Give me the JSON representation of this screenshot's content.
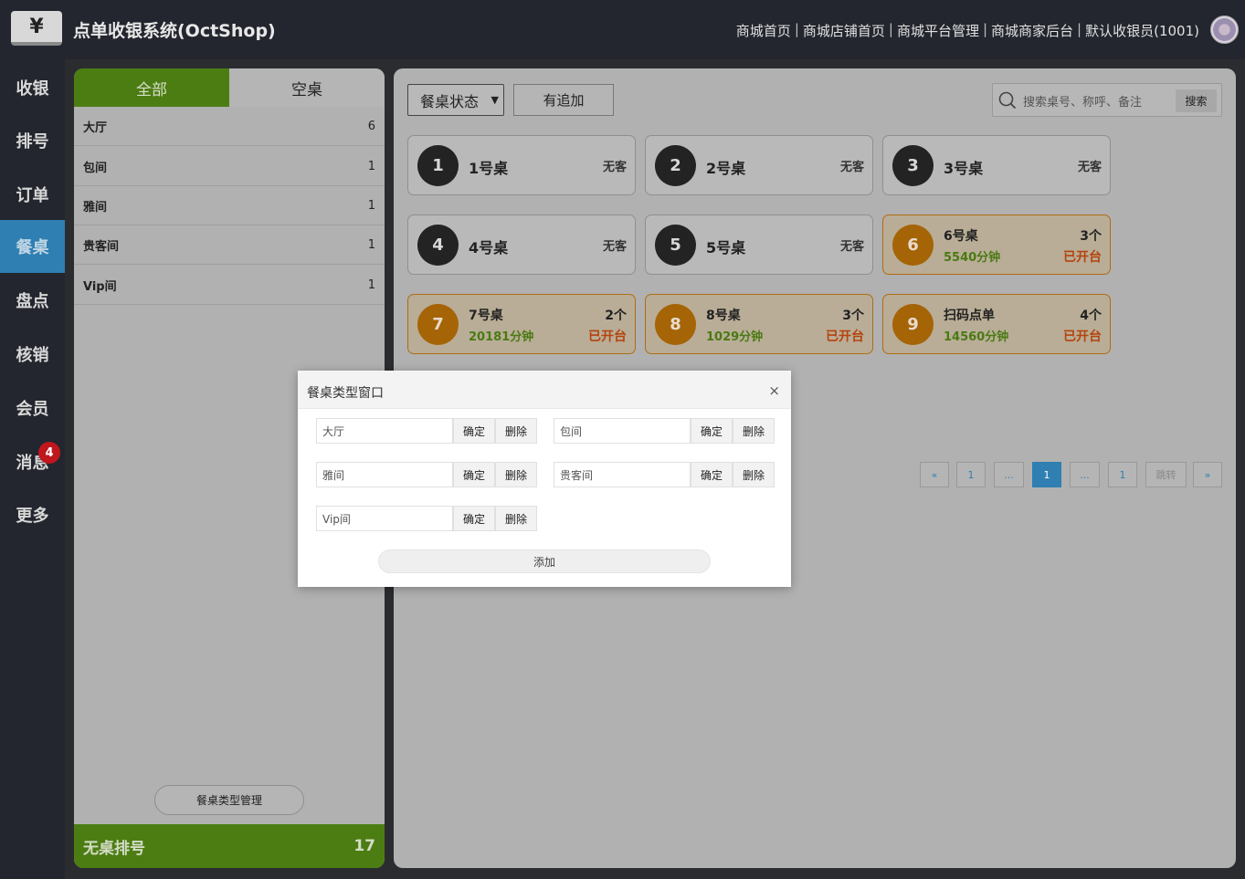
{
  "header": {
    "logo_glyph": "¥",
    "title": "点单收银系统(OctShop)",
    "nav": [
      "商城首页",
      "商城店铺首页",
      "商城平台管理",
      "商城商家后台",
      "默认收银员(1001)"
    ],
    "nav_separator": "|"
  },
  "leftnav": {
    "items": [
      {
        "label": "收银"
      },
      {
        "label": "排号"
      },
      {
        "label": "订单"
      },
      {
        "label": "餐桌",
        "active": true
      },
      {
        "label": "盘点"
      },
      {
        "label": "核销"
      },
      {
        "label": "会员"
      },
      {
        "label": "消息",
        "badge": "4"
      },
      {
        "label": "更多"
      }
    ]
  },
  "categories": {
    "tabs": [
      "全部",
      "空桌"
    ],
    "rows": [
      {
        "name": "大厅",
        "count": "6"
      },
      {
        "name": "包间",
        "count": "1"
      },
      {
        "name": "雅间",
        "count": "1"
      },
      {
        "name": "贵客间",
        "count": "1"
      },
      {
        "name": "Vip间",
        "count": "1"
      }
    ],
    "manage_button": "餐桌类型管理",
    "queue_label": "无桌排号",
    "queue_count": "17"
  },
  "toolbar": {
    "status_select": "餐桌状态",
    "add_button": "有追加",
    "search_placeholder": "搜索桌号、称呼、备注",
    "search_button": "搜索"
  },
  "tables": [
    {
      "num": "1",
      "name": "1号桌",
      "guest": "无客",
      "state": "empty"
    },
    {
      "num": "2",
      "name": "2号桌",
      "guest": "无客",
      "state": "empty"
    },
    {
      "num": "3",
      "name": "3号桌",
      "guest": "无客",
      "state": "empty"
    },
    {
      "num": "4",
      "name": "4号桌",
      "guest": "无客",
      "state": "empty"
    },
    {
      "num": "5",
      "name": "5号桌",
      "guest": "无客",
      "state": "empty"
    },
    {
      "num": "6",
      "name": "6号桌",
      "count": "3个",
      "minutes": "5540分钟",
      "status": "已开台",
      "state": "open"
    },
    {
      "num": "7",
      "name": "7号桌",
      "count": "2个",
      "minutes": "20181分钟",
      "status": "已开台",
      "state": "open"
    },
    {
      "num": "8",
      "name": "8号桌",
      "count": "3个",
      "minutes": "1029分钟",
      "status": "已开台",
      "state": "open"
    },
    {
      "num": "9",
      "name": "扫码点单",
      "count": "4个",
      "minutes": "14560分钟",
      "status": "已开台",
      "state": "open"
    }
  ],
  "pager": {
    "prev": "«",
    "first": "1",
    "ellipsis_left": "...",
    "current": "1",
    "ellipsis_right": "...",
    "last": "1",
    "jump_placeholder": "跳转",
    "next": "»"
  },
  "dialog": {
    "title": "餐桌类型窗口",
    "close": "×",
    "types": [
      "大厅",
      "包间",
      "雅间",
      "贵客间",
      "Vip间"
    ],
    "ok_label": "确定",
    "delete_label": "删除",
    "add_label": "添加"
  }
}
